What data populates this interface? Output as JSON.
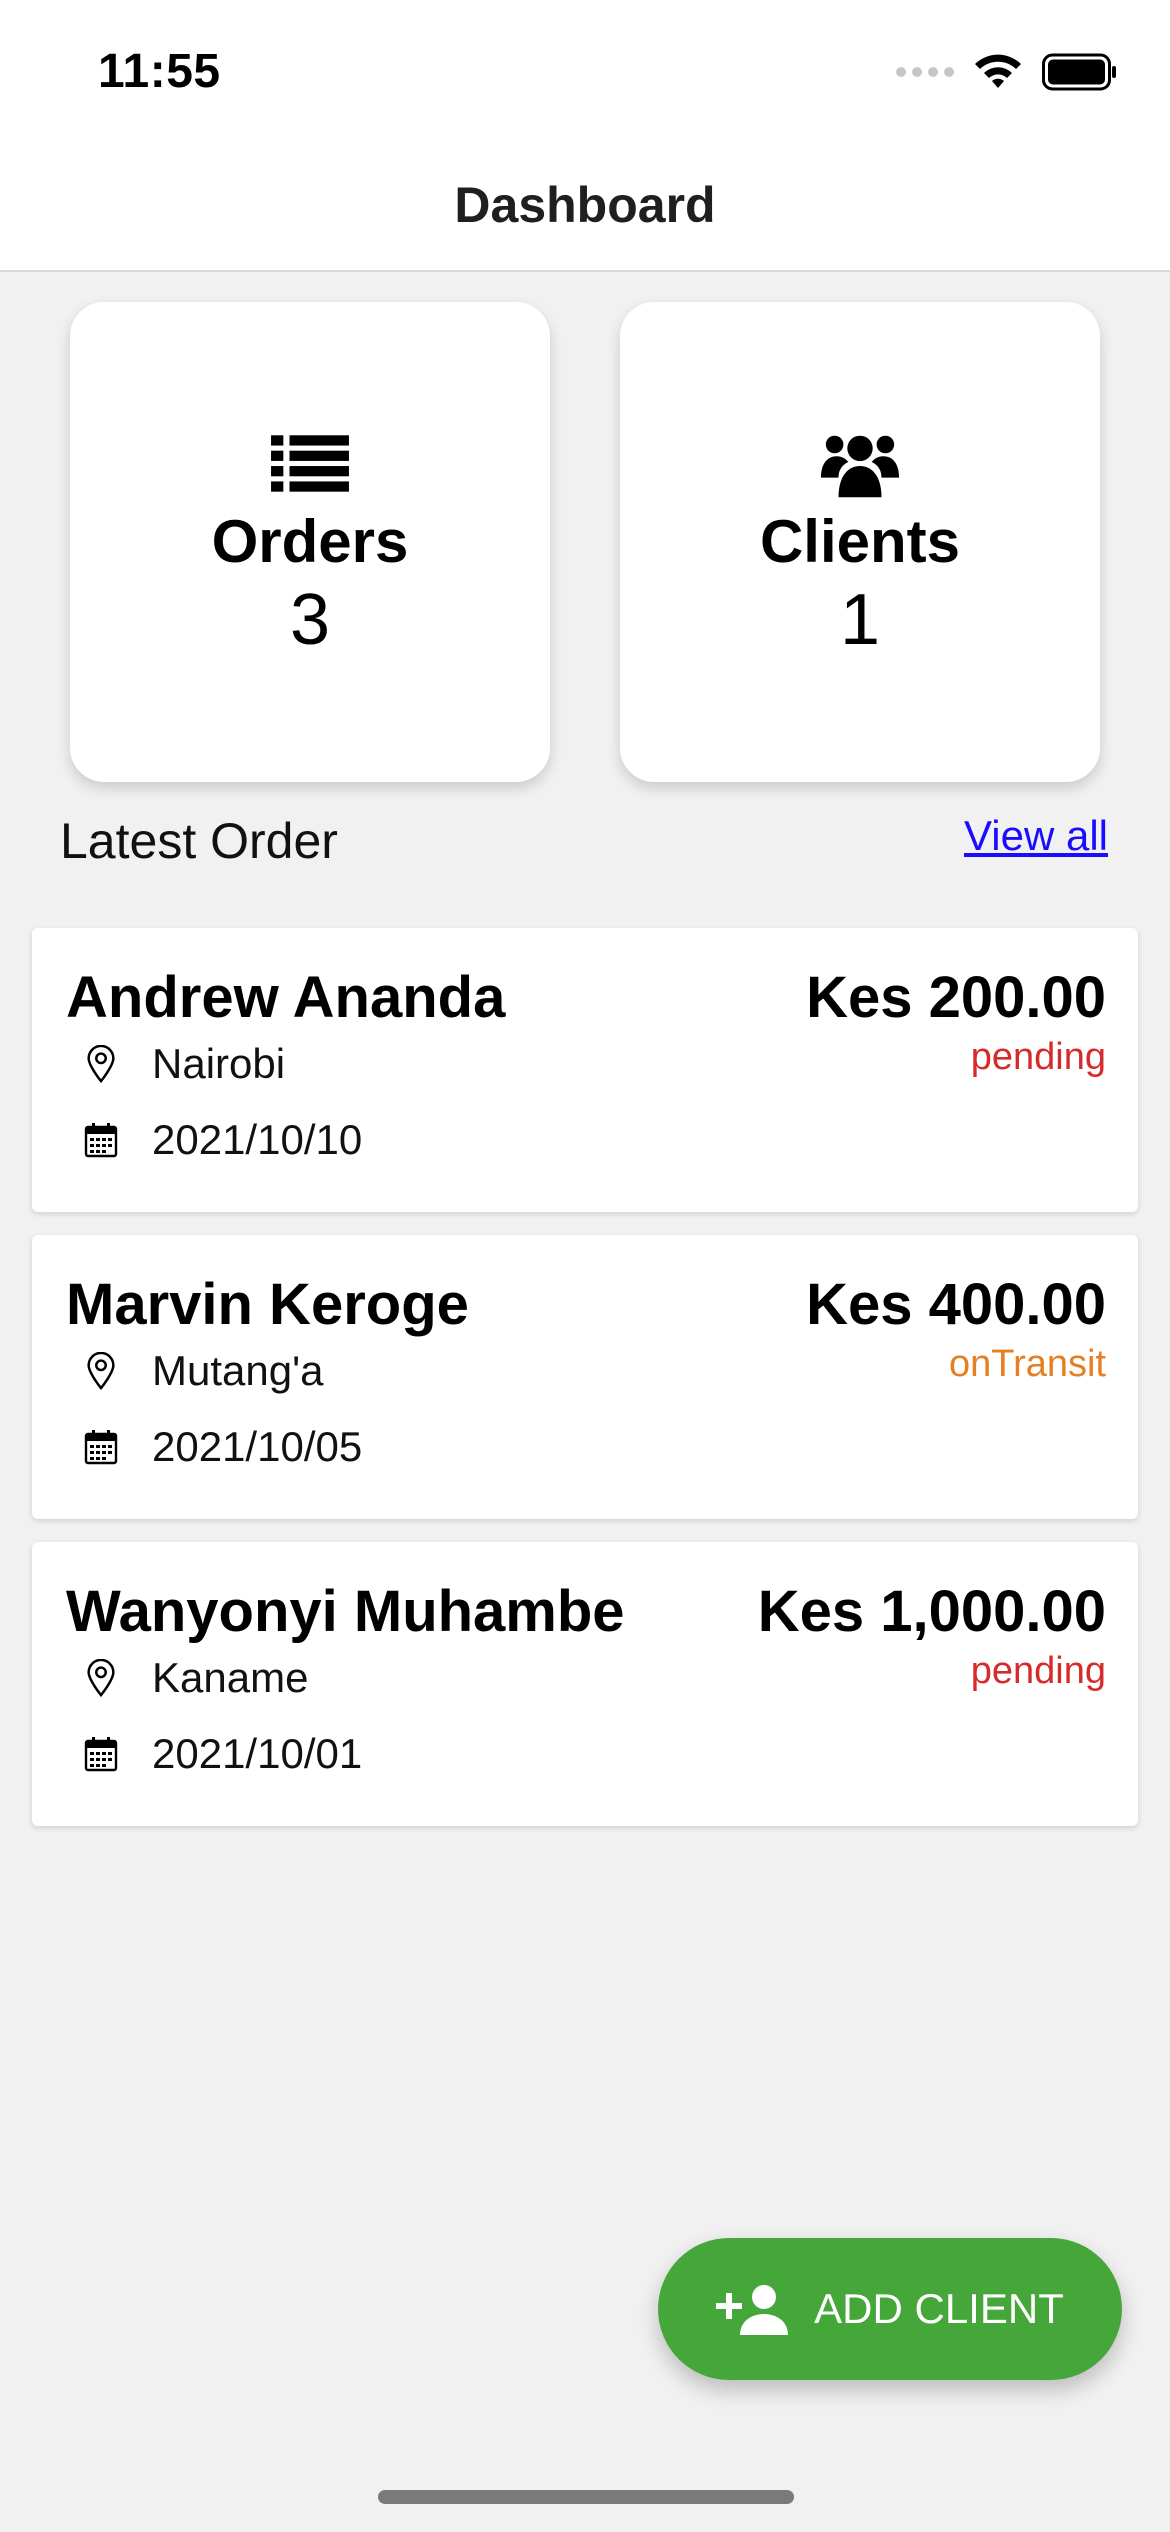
{
  "status_bar": {
    "time": "11:55"
  },
  "header": {
    "title": "Dashboard"
  },
  "stats": [
    {
      "label": "Orders",
      "value": "3",
      "icon": "list-icon"
    },
    {
      "label": "Clients",
      "value": "1",
      "icon": "users-icon"
    }
  ],
  "latest": {
    "title": "Latest Order",
    "view_all": "View all"
  },
  "orders": [
    {
      "name": "Andrew Ananda",
      "location": "Nairobi",
      "date": "2021/10/10",
      "amount": "Kes 200.00",
      "status": "pending"
    },
    {
      "name": "Marvin Keroge",
      "location": "Mutang'a",
      "date": "2021/10/05",
      "amount": "Kes 400.00",
      "status": "onTransit"
    },
    {
      "name": "Wanyonyi Muhambe",
      "location": "Kaname",
      "date": "2021/10/01",
      "amount": "Kes 1,000.00",
      "status": "pending"
    }
  ],
  "fab": {
    "label": "ADD CLIENT",
    "icon": "add-person-icon",
    "color": "#45a63a"
  },
  "colors": {
    "pending": "#d52b2b",
    "onTransit": "#e67e22",
    "link": "#1a0dff"
  }
}
